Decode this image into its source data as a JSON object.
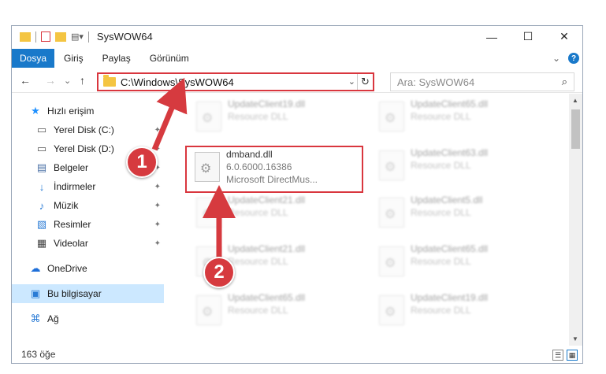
{
  "window": {
    "title": "SysWOW64"
  },
  "controls": {
    "minimize": "—",
    "maximize": "☐",
    "close": "✕"
  },
  "ribbon": {
    "file_tab": "Dosya",
    "tabs": [
      "Giriş",
      "Paylaş",
      "Görünüm"
    ],
    "collapse": "⌄",
    "help": "?"
  },
  "nav": {
    "back": "←",
    "forward": "→",
    "recent": "⌄",
    "up": "↑",
    "path": "C:\\Windows\\SysWOW64",
    "dropdown": "⌄",
    "refresh": "↻",
    "search_placeholder": "Ara: SysWOW64",
    "search_icon": "⌕"
  },
  "sidebar": {
    "items": [
      {
        "label": "Hızlı erişim",
        "icon": "star-icon",
        "glyph": "★",
        "color": "#1e90ff"
      },
      {
        "label": "Yerel Disk (C:)",
        "icon": "drive-icon",
        "glyph": "▭",
        "color": "#555555"
      },
      {
        "label": "Yerel Disk (D:)",
        "icon": "drive-icon",
        "glyph": "▭",
        "color": "#555555"
      },
      {
        "label": "Belgeler",
        "icon": "document-icon",
        "glyph": "▤",
        "color": "#4a6fa5"
      },
      {
        "label": "İndirmeler",
        "icon": "download-icon",
        "glyph": "↓",
        "color": "#2a7bd5"
      },
      {
        "label": "Müzik",
        "icon": "music-icon",
        "glyph": "♪",
        "color": "#2a7bd5"
      },
      {
        "label": "Resimler",
        "icon": "pictures-icon",
        "glyph": "▧",
        "color": "#2a7bd5"
      },
      {
        "label": "Videolar",
        "icon": "video-icon",
        "glyph": "▦",
        "color": "#444444"
      },
      {
        "label": "OneDrive",
        "icon": "cloud-icon",
        "glyph": "☁",
        "color": "#1e6fd9"
      },
      {
        "label": "Bu bilgisayar",
        "icon": "computer-icon",
        "glyph": "▣",
        "color": "#2a7bd5"
      },
      {
        "label": "Ağ",
        "icon": "network-icon",
        "glyph": "⌘",
        "color": "#2a7bd5"
      }
    ],
    "pin": "✦"
  },
  "files": {
    "ghost_left": [
      {
        "name": "UpdateClient19.dll",
        "type": "Resource DLL"
      },
      {
        "name": "UpdateClient21.dll",
        "type": "Resource DLL"
      },
      {
        "name": "UpdateClient21.dll",
        "type": "Resource DLL"
      },
      {
        "name": "UpdateClient65.dll",
        "type": "Resource DLL"
      }
    ],
    "ghost_right": [
      {
        "name": "UpdateClient65.dll",
        "type": "Resource DLL"
      },
      {
        "name": "UpdateClient63.dll",
        "type": "Resource DLL"
      },
      {
        "name": "UpdateClient5.dll",
        "type": "Resource DLL"
      },
      {
        "name": "UpdateClient65.dll",
        "type": "Resource DLL"
      },
      {
        "name": "UpdateClient19.dll",
        "type": "Resource DLL"
      }
    ],
    "target": {
      "name": "dmband.dll",
      "version": "6.0.6000.16386",
      "description": "Microsoft DirectMus..."
    }
  },
  "status": {
    "count": "163 öğe"
  },
  "annotations": {
    "step1": "1",
    "step2": "2",
    "color": "#d63a3f"
  }
}
